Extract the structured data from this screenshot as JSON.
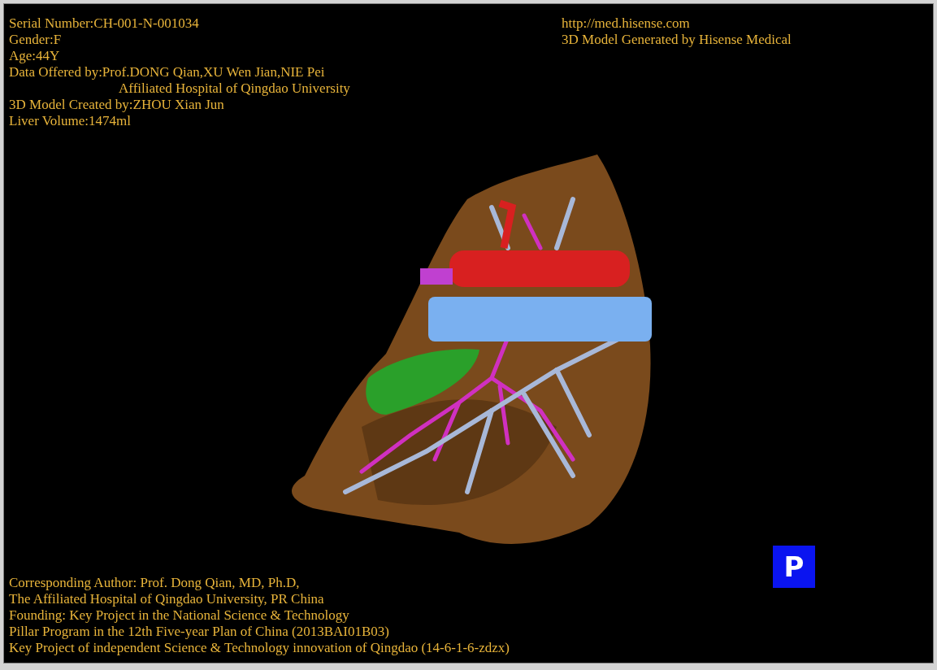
{
  "info": [
    {
      "kind": "line",
      "text": "Serial Number:CH-001-N-001034"
    },
    {
      "kind": "line",
      "text": "Gender:F"
    },
    {
      "kind": "line",
      "text": "Age:44Y"
    },
    {
      "kind": "line",
      "text": "Data Offered by:Prof.DONG Qian,XU Wen Jian,NIE Pei"
    },
    {
      "kind": "continuation",
      "text": "Affiliated Hospital of Qingdao University"
    },
    {
      "kind": "line",
      "text": "3D Model Created by:ZHOU Xian Jun"
    },
    {
      "kind": "line",
      "text": "Liver Volume:1474ml"
    }
  ],
  "website": {
    "url": "http://med.hisense.com",
    "credit": "3D Model Generated by Hisense Medical"
  },
  "credits": [
    "Corresponding Author: Prof. Dong Qian, MD, Ph.D,",
    "The Affiliated Hospital of Qingdao University, PR China",
    "Founding: Key Project in the National Science & Technology",
    "Pillar Program in the 12th Five-year Plan of China (2013BAI01B03)",
    "Key Project of independent Science & Technology innovation of Qingdao (14-6-1-6-zdzx)"
  ],
  "orientation_marker": "P"
}
